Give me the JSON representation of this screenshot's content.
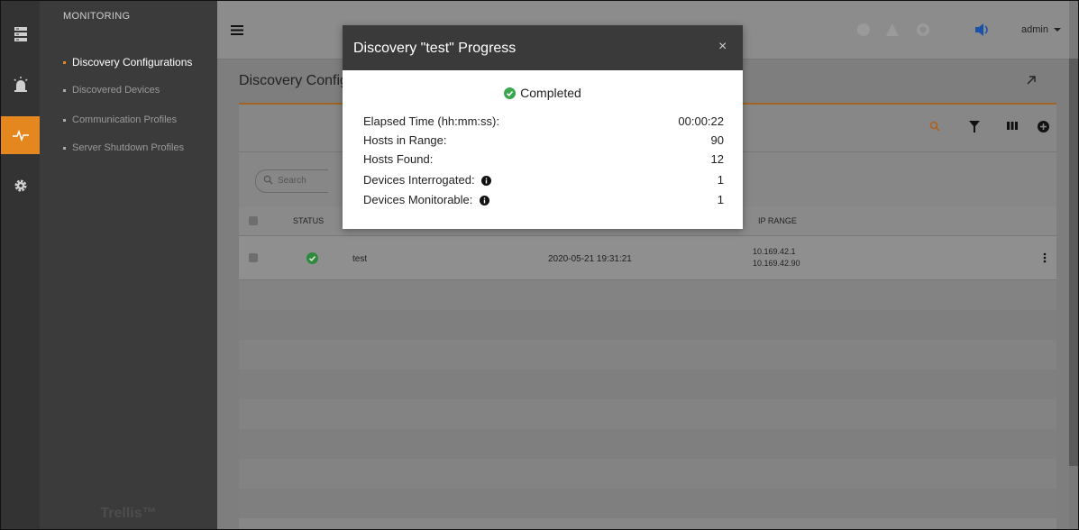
{
  "nav": {
    "section_title": "MONITORING",
    "items": [
      {
        "label": "Discovery Configurations",
        "active": true
      },
      {
        "label": "Discovered Devices",
        "active": false
      },
      {
        "label": "Communication Profiles",
        "active": false
      },
      {
        "label": "Server Shutdown Profiles",
        "active": false
      }
    ],
    "brand": "Trellis™"
  },
  "topbar": {
    "user": "admin"
  },
  "page": {
    "title": "Discovery Configurations"
  },
  "search": {
    "placeholder": "Search"
  },
  "table": {
    "headers": {
      "status": "STATUS",
      "ip_range": "IP RANGE"
    },
    "rows": [
      {
        "name": "test",
        "date": "2020-05-21 19:31:21",
        "ip_start": "10.169.42.1",
        "ip_end": "10.169.42.90"
      }
    ]
  },
  "modal": {
    "title": "Discovery \"test\" Progress",
    "close": "×",
    "status": "Completed",
    "stats": [
      {
        "label": "Elapsed Time (hh:mm:ss):",
        "value": "00:00:22"
      },
      {
        "label": "Hosts in Range:",
        "value": "90"
      },
      {
        "label": "Hosts Found:",
        "value": "12"
      },
      {
        "label": "Devices Interrogated:",
        "value": "1"
      },
      {
        "label": "Devices Monitorable:",
        "value": "1"
      }
    ]
  },
  "colors": {
    "accent": "#e5871f",
    "success": "#3aa64f",
    "header_dark": "#3a3a3a"
  }
}
